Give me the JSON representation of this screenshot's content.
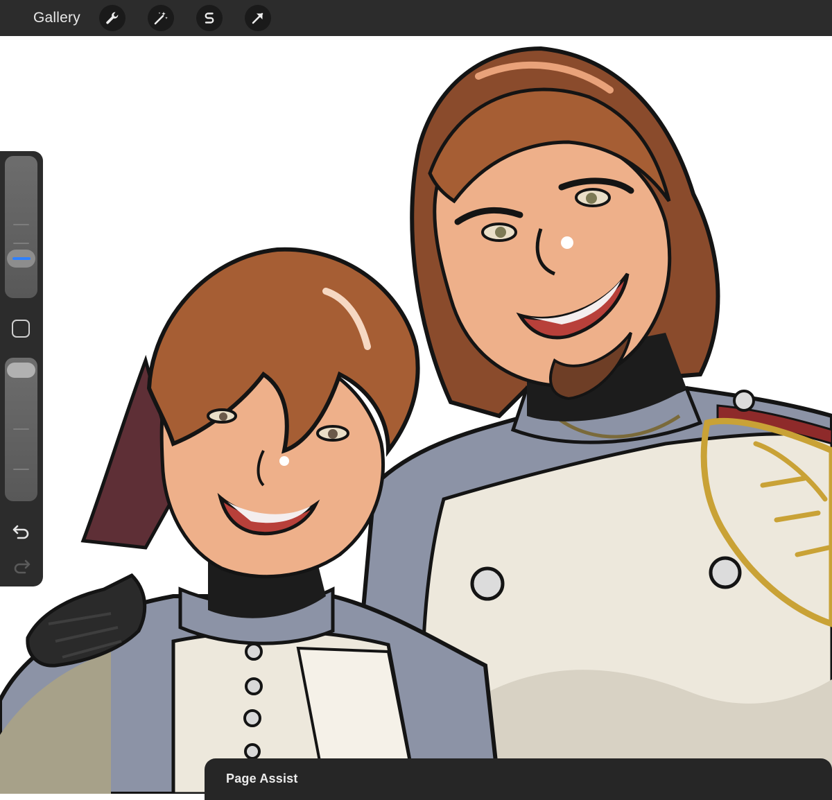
{
  "toolbar": {
    "gallery_label": "Gallery",
    "tools": [
      {
        "name": "actions",
        "icon": "wrench-icon"
      },
      {
        "name": "adjustments",
        "icon": "magic-wand-icon"
      },
      {
        "name": "selection",
        "icon": "selection-s-icon"
      },
      {
        "name": "transform",
        "icon": "arrow-cursor-icon"
      }
    ]
  },
  "sidebar": {
    "brush_size_level": 0.62,
    "brush_opacity_level": 0.0,
    "modify_icon": "square-modify-icon",
    "undo_icon": "undo-arrow-icon",
    "redo_icon": "redo-arrow-icon",
    "accent_color": "#2f80ff"
  },
  "canvas": {
    "content": "illustration-artwork",
    "colors": {
      "background": "#ffffff",
      "skin": "#eeb08a",
      "hair": "#a65e34",
      "uniform_gray": "#8c93a6",
      "uniform_white": "#ede8dc",
      "gold_trim": "#c9a236",
      "ink": "#141414"
    }
  },
  "bottom_panel": {
    "title": "Page Assist"
  }
}
